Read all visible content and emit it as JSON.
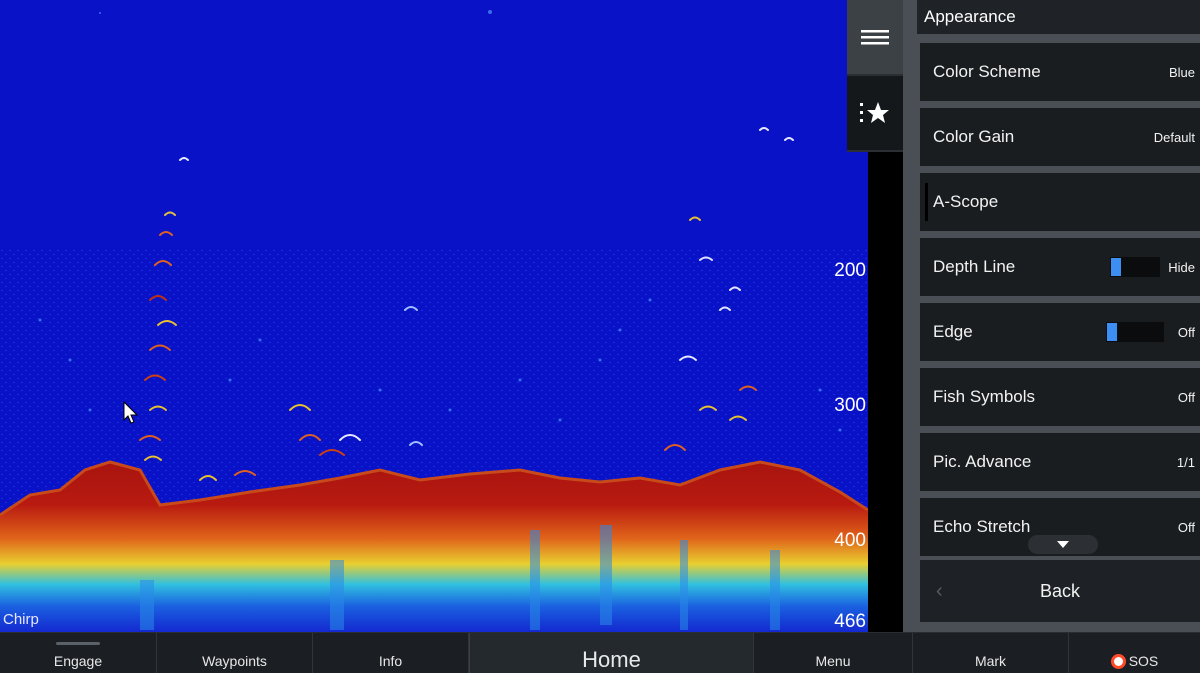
{
  "sonar": {
    "mode_label": "Chirp",
    "depth_labels": [
      "200",
      "300",
      "400",
      "466"
    ],
    "colors": {
      "water": "#0a12c8",
      "bottom": "#a01410",
      "bottom_mid": "#e05a10",
      "bottom_low": "#20b4d8"
    }
  },
  "toolbar": {
    "menu_icon": "menu-icon",
    "favorites_icon": "favorites-star-icon"
  },
  "panel": {
    "title": "Appearance",
    "items": [
      {
        "label": "Color Scheme",
        "value": "Blue"
      },
      {
        "label": "Color Gain",
        "value": "Default"
      },
      {
        "label": "A-Scope",
        "value": ""
      },
      {
        "label": "Depth Line",
        "value": "Hide"
      },
      {
        "label": "Edge",
        "value": "Off"
      },
      {
        "label": "Fish Symbols",
        "value": "Off"
      },
      {
        "label": "Pic. Advance",
        "value": "1/1"
      },
      {
        "label": "Echo Stretch",
        "value": "Off"
      }
    ],
    "back_label": "Back"
  },
  "bottombar": {
    "engage": "Engage",
    "waypoints": "Waypoints",
    "info": "Info",
    "home": "Home",
    "menu": "Menu",
    "mark": "Mark",
    "sos": "SOS"
  }
}
